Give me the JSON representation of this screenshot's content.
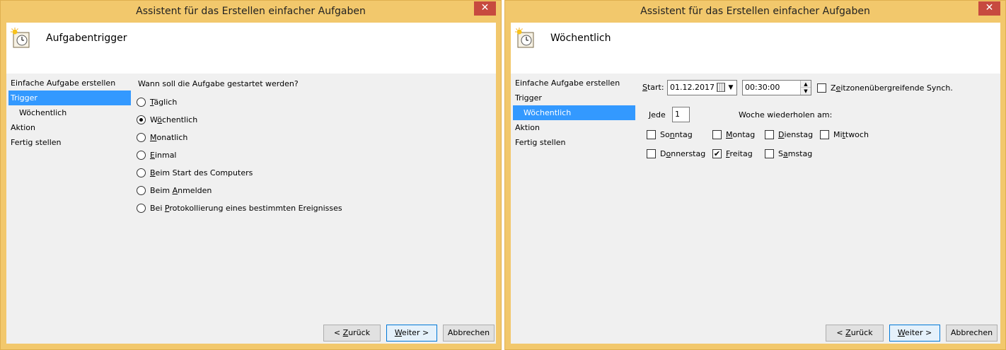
{
  "left_window": {
    "title": "Assistent für das Erstellen einfacher Aufgaben",
    "header_title": "Aufgabentrigger",
    "nav": [
      {
        "label": "Einfache Aufgabe erstellen"
      },
      {
        "label": "Trigger"
      },
      {
        "label": "Wöchentlich"
      },
      {
        "label": "Aktion"
      },
      {
        "label": "Fertig stellen"
      }
    ],
    "question": "Wann soll die Aufgabe gestartet werden?",
    "options": [
      {
        "pre": "",
        "acc": "T",
        "post": "äglich",
        "checked": false
      },
      {
        "pre": "W",
        "acc": "ö",
        "post": "chentlich",
        "checked": true
      },
      {
        "pre": "",
        "acc": "M",
        "post": "onatlich",
        "checked": false
      },
      {
        "pre": "",
        "acc": "E",
        "post": "inmal",
        "checked": false
      },
      {
        "pre": "",
        "acc": "B",
        "post": "eim Start des Computers",
        "checked": false
      },
      {
        "pre": "Beim ",
        "acc": "A",
        "post": "nmelden",
        "checked": false
      },
      {
        "pre": "Bei ",
        "acc": "P",
        "post": "rotokollierung eines bestimmten Ereignisses",
        "checked": false
      }
    ],
    "buttons": {
      "back_pre": "< ",
      "back_acc": "Z",
      "back_post": "urück",
      "next_acc": "W",
      "next_post": "eiter >",
      "cancel": "Abbrechen"
    }
  },
  "right_window": {
    "title": "Assistent für das Erstellen einfacher Aufgaben",
    "header_title": "Wöchentlich",
    "nav": [
      {
        "label": "Einfache Aufgabe erstellen"
      },
      {
        "label": "Trigger"
      },
      {
        "label": "Wöchentlich"
      },
      {
        "label": "Aktion"
      },
      {
        "label": "Fertig stellen"
      }
    ],
    "start_label_acc": "S",
    "start_label_post": "tart:",
    "date_value": "01.12.2017",
    "time_value": "00:30:00",
    "sync_pre": "Z",
    "sync_acc": "e",
    "sync_post": "itzonenübergreifende Synch.",
    "every_acc": "J",
    "every_post": "ede",
    "every_value": "1",
    "repeat_label": "Woche wiederholen am:",
    "days": [
      {
        "pre": "So",
        "acc": "n",
        "post": "ntag",
        "checked": false
      },
      {
        "pre": "",
        "acc": "M",
        "post": "ontag",
        "checked": false
      },
      {
        "pre": "",
        "acc": "D",
        "post": "ienstag",
        "checked": false
      },
      {
        "pre": "Mi",
        "acc": "t",
        "post": "twoch",
        "checked": false
      },
      {
        "pre": "D",
        "acc": "o",
        "post": "nnerstag",
        "checked": false
      },
      {
        "pre": "",
        "acc": "F",
        "post": "reitag",
        "checked": true
      },
      {
        "pre": "S",
        "acc": "a",
        "post": "mstag",
        "checked": false
      }
    ],
    "buttons": {
      "back_pre": "< ",
      "back_acc": "Z",
      "back_post": "urück",
      "next_acc": "W",
      "next_post": "eiter >",
      "cancel": "Abbrechen"
    }
  },
  "colors": {
    "titlebar": "#f2c86c",
    "selection": "#3399ff",
    "close": "#c74a3f"
  }
}
